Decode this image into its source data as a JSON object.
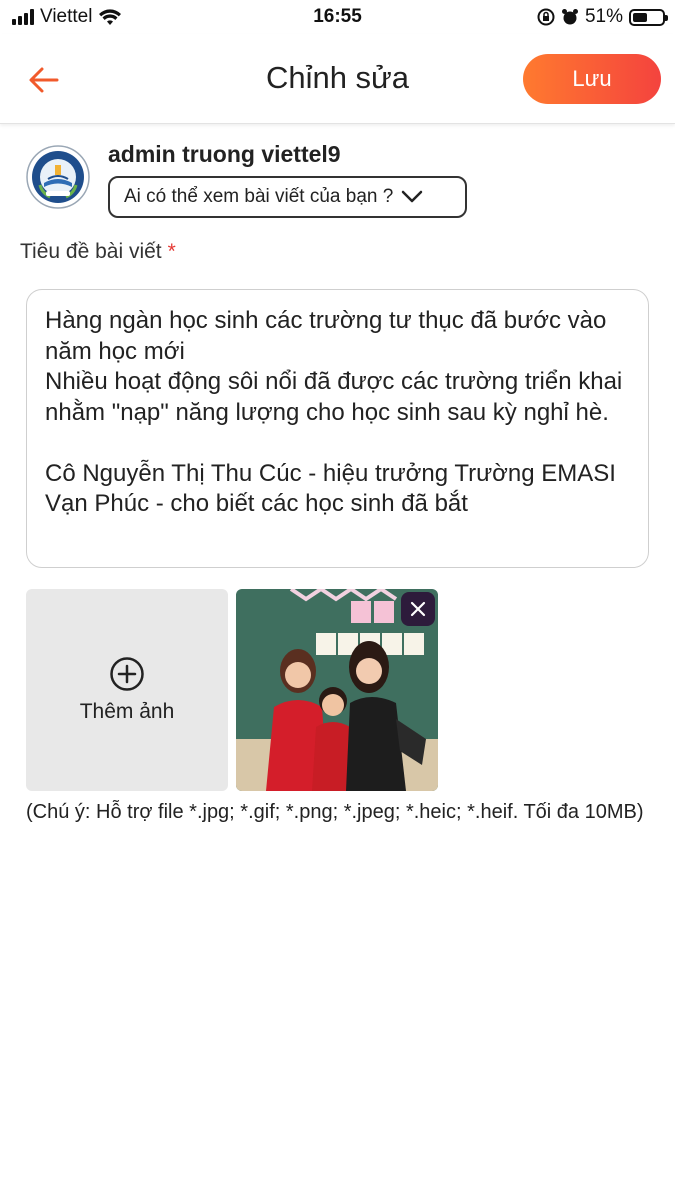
{
  "status_bar": {
    "carrier": "Viettel",
    "time": "16:55",
    "battery": "51%",
    "battery_level": 0.51
  },
  "header": {
    "back_icon": "arrow-left-icon",
    "title": "Chỉnh sửa",
    "save_label": "Lưu",
    "accent_color": "#f15a2b"
  },
  "author": {
    "name": "admin truong viettel9",
    "avatar_icon": "school-logo-icon",
    "privacy_placeholder": "Ai có thể xem bài viết của bạn ?"
  },
  "post": {
    "title_label": "Tiêu đề bài viết",
    "required_mark": "*",
    "content": "Hàng ngàn học sinh các trường tư thục đã bước vào năm học mới\nNhiều hoạt động sôi nổi đã được các trường triển khai nhằm \"nạp\" năng lượng cho học sinh sau kỳ nghỉ hè.\n\nCô Nguyễn Thị Thu Cúc - hiệu trưởng Trường EMASI Vạn Phúc - cho biết các học sinh đã bắt"
  },
  "media": {
    "add_photo_label": "Thêm ảnh",
    "add_icon": "plus-circle-icon",
    "remove_icon": "close-icon",
    "note": "(Chú ý: Hỗ trợ file *.jpg; *.gif; *.png; *.jpeg; *.heic; *.heif. Tối đa 10MB)"
  }
}
